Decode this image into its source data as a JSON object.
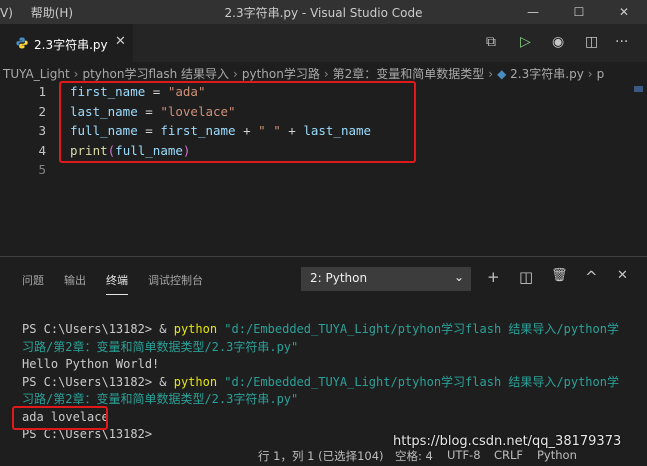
{
  "titlebar": {
    "menu_view": "V)",
    "menu_help": "帮助(H)",
    "title": "2.3字符串.py - Visual Studio Code",
    "minimize": "—",
    "maximize": "☐",
    "close": "✕"
  },
  "tab": {
    "label": "2.3字符串.py",
    "close": "✕"
  },
  "tab_actions": {
    "open_preview": "⧉",
    "run": "▷",
    "compare": "◉",
    "split": "◫",
    "more": "···"
  },
  "breadcrumb": {
    "items": [
      "TUYA_Light",
      "ptyhon学习flash 结果导入",
      "python学习路",
      "第2章：变量和简单数据类型",
      "2.3字符串.py"
    ],
    "tail": "p"
  },
  "editor": {
    "line_numbers": [
      "1",
      "2",
      "3",
      "4",
      "5"
    ],
    "lines": [
      {
        "a": "first_name",
        "b": " = ",
        "c": "\"ada\""
      },
      {
        "a": "last_name",
        "b": " = ",
        "c": "\"lovelace\""
      },
      {
        "a": "full_name",
        "b": " = ",
        "c": "first_name",
        "d": " + ",
        "e": "\" \"",
        "f": " + ",
        "g": "last_name"
      },
      {
        "a": "print",
        "b": "(",
        "c": "full_name",
        "d": ")"
      }
    ]
  },
  "panel": {
    "tabs": [
      "问题",
      "输出",
      "终端",
      "调试控制台"
    ],
    "active_tab": "终端",
    "terminal_select": "2: Python",
    "actions": {
      "add": "+",
      "split": "◫",
      "trash": "🗑",
      "maximize": "^",
      "close": "✕"
    }
  },
  "terminal": {
    "prompt1": "PS C:\\Users\\13182> & ",
    "cmd1": "python",
    "path1a": " \"d:/Embedded_TUYA_Light/ptyhon学习flash 结果导入/python学",
    "path1b": "习路/第2章：变量和简单数据类型/2.3字符串.py\"",
    "out1": "Hello Python World!",
    "prompt2": "PS C:\\Users\\13182> & ",
    "cmd2": "python",
    "path2a": " \"d:/Embedded_TUYA_Light/ptyhon学习flash 结果导入/python学",
    "path2b": "习路/第2章：变量和简单数据类型/2.3字符串.py\"",
    "out2": "ada lovelace",
    "prompt3": "PS C:\\Users\\13182>"
  },
  "statusbar": {
    "position": "行 1，列 1 (已选择104)",
    "spaces": "空格: 4",
    "encoding": "UTF-8",
    "eol": "CRLF",
    "language": "Python"
  },
  "watermark": "https://blog.csdn.net/qq_38179373",
  "colors": {
    "highlight_box": "#e01a1a",
    "string": "#ce9178",
    "variable": "#9cdcfe",
    "function": "#dcdcaa",
    "terminal_command": "#e5e510",
    "terminal_path": "#2aa198"
  }
}
